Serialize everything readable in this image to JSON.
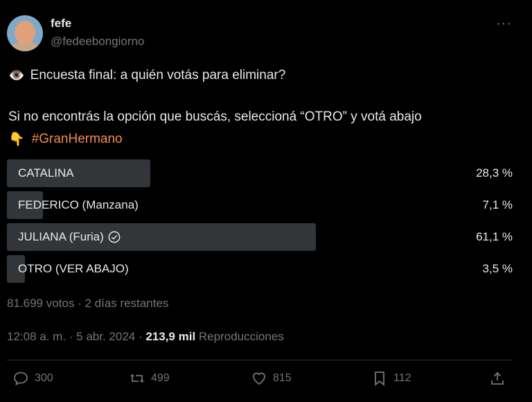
{
  "user": {
    "display_name": "fefe",
    "handle": "@fedeebongiorno"
  },
  "more_label": "···",
  "tweet": {
    "line1_emoji": "👁️",
    "line1_text": "Encuesta final: a quién votás para eliminar?",
    "line2_text": "Si no encontrás la opción que buscás, seleccioná “OTRO” y votá abajo",
    "line3_emoji": "👇",
    "hashtag": "#GranHermano"
  },
  "poll": {
    "options": [
      {
        "label": "CATALINA",
        "percent_text": "28,3 %",
        "percent": 28.3,
        "selected": false
      },
      {
        "label": "FEDERICO (Manzana)",
        "percent_text": "7,1 %",
        "percent": 7.1,
        "selected": false
      },
      {
        "label": "JULIANA (Furia)",
        "percent_text": "61,1 %",
        "percent": 61.1,
        "selected": true
      },
      {
        "label": "OTRO (VER ABAJO)",
        "percent_text": "3,5 %",
        "percent": 3.5,
        "selected": false
      }
    ],
    "meta": "81.699 votos · 2 días restantes"
  },
  "timestamp": "12:08 a. m. · 5 abr. 2024 · ",
  "views_count": "213,9 mil",
  "views_label": " Reproducciones",
  "actions": {
    "replies": "300",
    "reposts": "499",
    "likes": "815",
    "bookmarks": "112"
  },
  "colors": {
    "background": "#000000",
    "text": "#e7e9ea",
    "muted": "#71767b",
    "bar": "#333639",
    "hashtag": "#f48a4b"
  }
}
